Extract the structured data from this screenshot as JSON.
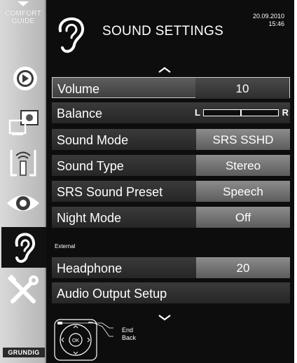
{
  "sidebar": {
    "comfort_guide": "COMFORT\nGUIDE",
    "items": [
      {
        "name": "media-player-icon"
      },
      {
        "name": "source-icon"
      },
      {
        "name": "remote-signal-icon"
      },
      {
        "name": "eye-icon"
      },
      {
        "name": "sound-ear-icon",
        "active": true
      },
      {
        "name": "tools-icon"
      }
    ],
    "brand": "GRUNDIG"
  },
  "header": {
    "title": "SOUND SETTINGS",
    "date": "20.09.2010",
    "time": "15:46"
  },
  "menu": [
    {
      "label": "Volume",
      "value": "10",
      "selected": true
    },
    {
      "label": "Balance",
      "type": "balance",
      "left": "L",
      "right": "R"
    },
    {
      "label": "Sound Mode",
      "value": "SRS SSHD"
    },
    {
      "label": "Sound Type",
      "value": "Stereo"
    },
    {
      "label": "SRS Sound Preset",
      "value": "Speech"
    },
    {
      "label": "Night Mode",
      "value": "Off"
    }
  ],
  "external": {
    "section_label": "External",
    "items": [
      {
        "label": "Headphone",
        "value": "20"
      },
      {
        "label": "Audio Output Setup"
      }
    ]
  },
  "footer": {
    "ok_label": "OK",
    "legend_end": "End",
    "legend_back": "Back"
  }
}
